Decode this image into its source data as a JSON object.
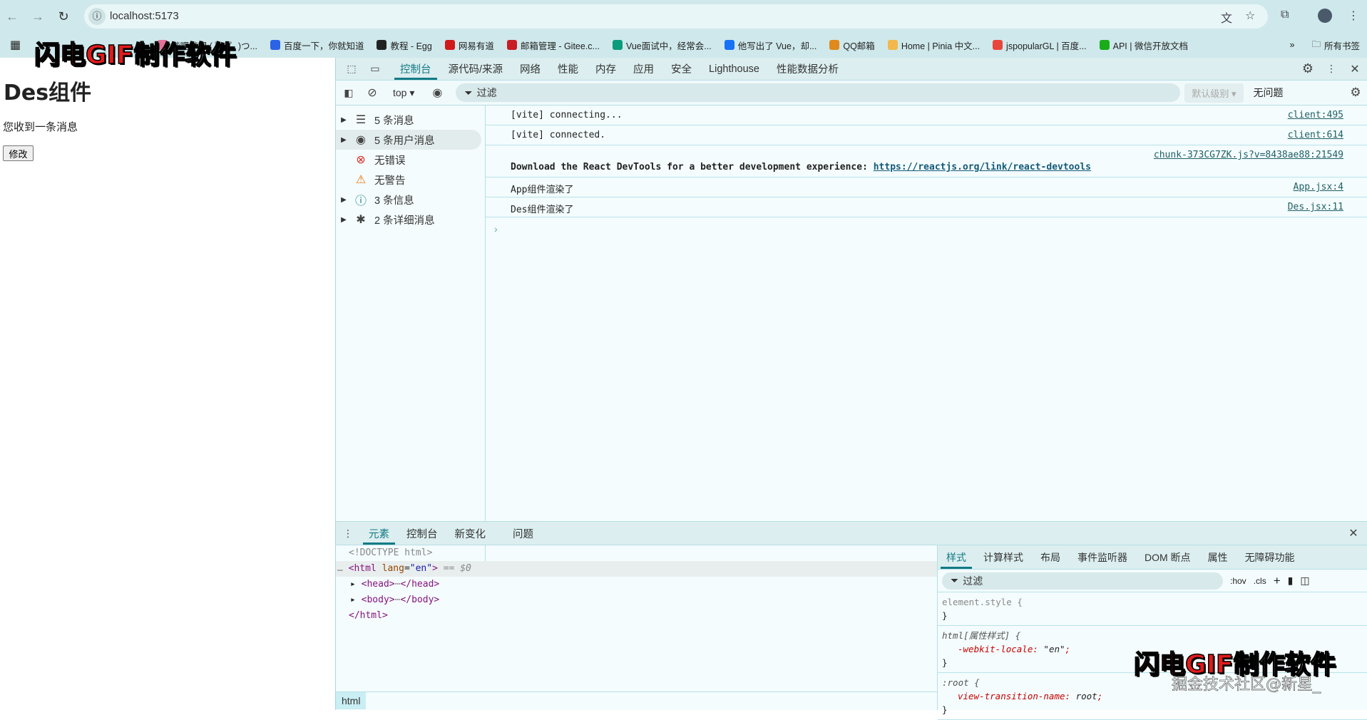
{
  "browser": {
    "url": "localhost:5173",
    "bookmarks": [
      {
        "label": "哔哩哔哩 ( ゜- ゜)つ...",
        "color": "#e4729a"
      },
      {
        "label": "百度一下，你就知道",
        "color": "#2b62e6"
      },
      {
        "label": "教程 - Egg",
        "color": "#222"
      },
      {
        "label": "网易有道",
        "color": "#d01a1a"
      },
      {
        "label": "邮箱管理 - Gitee.c...",
        "color": "#c71d23"
      },
      {
        "label": "Vue面试中，经常会...",
        "color": "#0c9b7c"
      },
      {
        "label": "他写出了 Vue，却...",
        "color": "#1772f6"
      },
      {
        "label": "QQ邮箱",
        "color": "#e08a1e"
      },
      {
        "label": "Home | Pinia 中文...",
        "color": "#f2b84b"
      },
      {
        "label": "jspopularGL | 百度...",
        "color": "#e8453c"
      },
      {
        "label": "API | 微信开放文档",
        "color": "#1aad19"
      }
    ],
    "all_bookmarks": "所有书签"
  },
  "page": {
    "title": "Des组件",
    "message": "您收到一条消息",
    "button": "修改"
  },
  "devtools": {
    "tabs": [
      "控制台",
      "源代码/来源",
      "网络",
      "性能",
      "内存",
      "应用",
      "安全",
      "Lighthouse",
      "性能数据分析"
    ],
    "context": "top",
    "filter_placeholder": "过滤",
    "level": "默认级别",
    "issues": "无问题",
    "sidebar": [
      {
        "label": "5 条消息",
        "icon": "list-icon",
        "expand": true
      },
      {
        "label": "5 条用户消息",
        "icon": "user-icon",
        "expand": true
      },
      {
        "label": "无错误",
        "icon": "error-icon",
        "expand": false
      },
      {
        "label": "无警告",
        "icon": "warning-icon",
        "expand": false
      },
      {
        "label": "3 条信息",
        "icon": "info-icon",
        "expand": true
      },
      {
        "label": "2 条详细消息",
        "icon": "bug-icon",
        "expand": true
      }
    ],
    "messages": [
      {
        "text": "[vite] connecting...",
        "source": "client:495"
      },
      {
        "text": "[vite] connected.",
        "source": "client:614"
      },
      {
        "text": "Download the React DevTools for a better development experience: ",
        "link": "https://reactjs.org/link/react-devtools",
        "source": "chunk-373CG7ZK.js?v=8438ae88:21549"
      },
      {
        "text": "App组件渲染了",
        "source": "App.jsx:4"
      },
      {
        "text": "Des组件渲染了",
        "source": "Des.jsx:11"
      }
    ],
    "drawer_tabs": [
      "元素",
      "控制台",
      "新变化",
      "问题"
    ],
    "elements": {
      "doctype": "<!DOCTYPE html>",
      "html_open": "<html",
      "lang_attr": "lang",
      "lang_val": "\"en\"",
      "selected_marker": "== $0",
      "head": "<head>",
      "head_close": "</head>",
      "body": "<body>",
      "body_close": "</body>",
      "html_close": "</html>",
      "breadcrumb": "html"
    },
    "style_tabs": [
      "样式",
      "计算样式",
      "布局",
      "事件监听器",
      "DOM 断点",
      "属性",
      "无障碍功能"
    ],
    "styles_filter": "过滤",
    "hov": ":hov",
    "cls": ".cls",
    "rules": [
      {
        "selector": "element.style {",
        "props": []
      },
      {
        "selector": "html[属性样式] {",
        "props": [
          {
            "name": "-webkit-locale",
            "value": "\"en\""
          }
        ]
      },
      {
        "selector": ":root {",
        "props": [
          {
            "name": "view-transition-name",
            "value": "root"
          }
        ]
      }
    ]
  },
  "watermark": {
    "red": "闪电GIF",
    "black": "制作软件",
    "credit": "掘金技术社区@新星_"
  },
  "colors": {
    "accent": "#137a86",
    "chrome": "#cfe8eb"
  }
}
